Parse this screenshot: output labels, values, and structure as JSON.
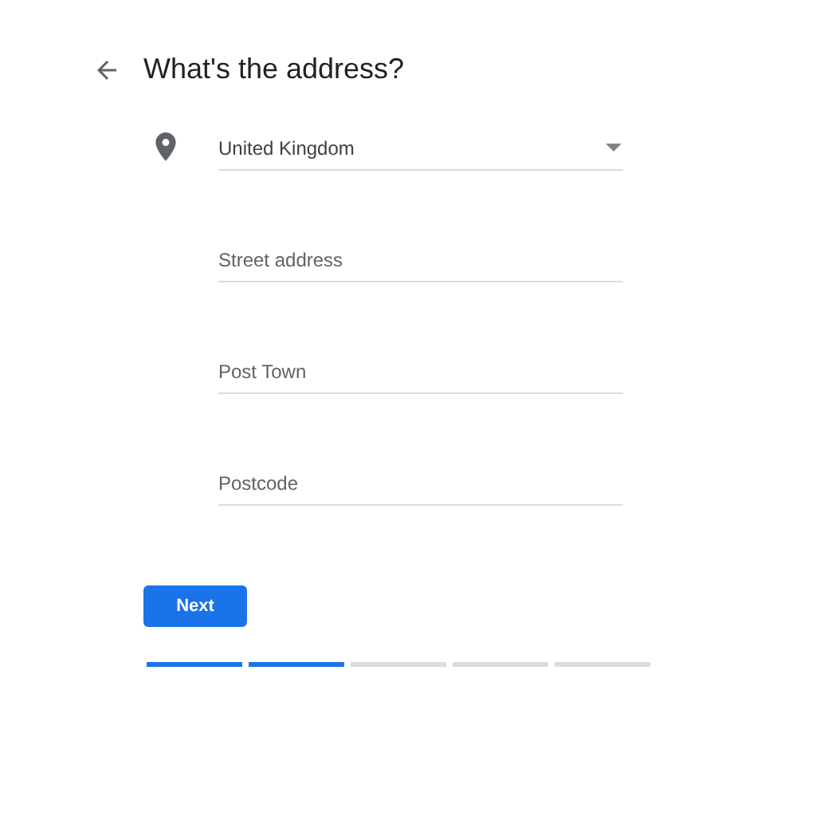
{
  "header": {
    "title": "What's the address?"
  },
  "fields": [
    {
      "kind": "select",
      "value": "United Kingdom"
    },
    {
      "kind": "text",
      "placeholder": "Street address"
    },
    {
      "kind": "text",
      "placeholder": "Post Town"
    },
    {
      "kind": "text",
      "placeholder": "Postcode"
    }
  ],
  "next_button": {
    "label": "Next"
  },
  "progress": [
    {
      "complete": true
    },
    {
      "complete": true
    },
    {
      "complete": false
    },
    {
      "complete": false
    },
    {
      "complete": false
    }
  ]
}
